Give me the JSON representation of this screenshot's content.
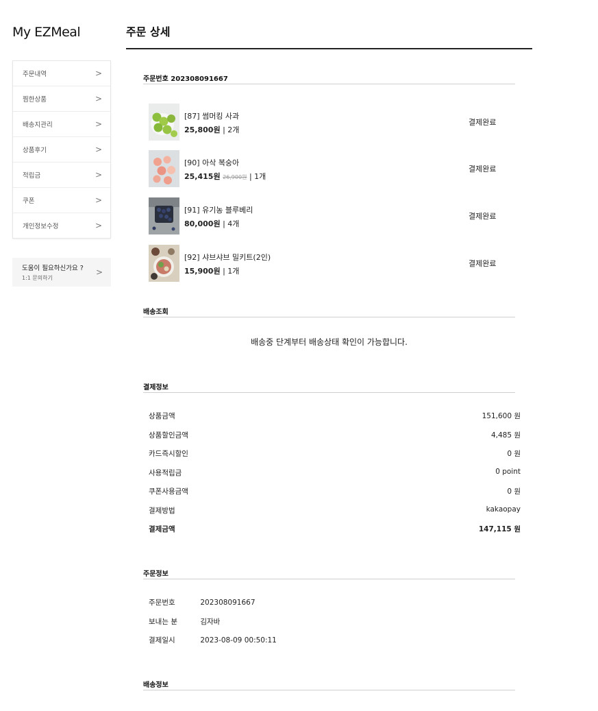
{
  "brand": "My EZMeal",
  "sidebar": {
    "items": [
      {
        "label": "주문내역"
      },
      {
        "label": "찜한상품"
      },
      {
        "label": "배송지관리"
      },
      {
        "label": "상품후기"
      },
      {
        "label": "적립금"
      },
      {
        "label": "쿠폰"
      },
      {
        "label": "개인정보수정"
      }
    ],
    "chevron": ">",
    "help": {
      "title": "도움이 필요하신가요 ?",
      "sub": "1:1 문의하기"
    }
  },
  "page": {
    "title": "주문 상세"
  },
  "order": {
    "header": "주문번호 202308091667",
    "products": [
      {
        "name": "[87] 썸머킹 사과",
        "price": "25,800원",
        "original": "",
        "qty": "| 2개",
        "status": "결제완료",
        "image": "green-apples"
      },
      {
        "name": "[90] 아삭 복숭아",
        "price": "25,415원",
        "original": "26,900원",
        "qty": "| 1개",
        "status": "결제완료",
        "image": "peaches"
      },
      {
        "name": "[91] 유기농 블루베리",
        "price": "80,000원",
        "original": "",
        "qty": "| 4개",
        "status": "결제완료",
        "image": "blueberries"
      },
      {
        "name": "[92] 샤브샤브 밀키트(2인)",
        "price": "15,900원",
        "original": "",
        "qty": "| 1개",
        "status": "결제완료",
        "image": "shabu-shabu-meal-kit"
      }
    ]
  },
  "delivery": {
    "header": "배송조회",
    "notice": "배송중 단계부터 배송상태 확인이 가능합니다."
  },
  "payment": {
    "header": "결제정보",
    "rows": [
      {
        "label": "상품금액",
        "value": "151,600 원"
      },
      {
        "label": "상품할인금액",
        "value": "4,485 원"
      },
      {
        "label": "카드즉시할인",
        "value": "0 원"
      },
      {
        "label": "사용적립금",
        "value": "0 point"
      },
      {
        "label": "쿠폰사용금액",
        "value": "0 원"
      },
      {
        "label": "결제방법",
        "value": "kakaopay"
      },
      {
        "label": "결제금액",
        "value": "147,115 원"
      }
    ]
  },
  "order_info": {
    "header": "주문정보",
    "rows": [
      {
        "label": "주문번호",
        "value": "202308091667"
      },
      {
        "label": "보내는 분",
        "value": "김자바"
      },
      {
        "label": "결제일시",
        "value": "2023-08-09 00:50:11"
      }
    ]
  },
  "shipping": {
    "header": "배송정보"
  }
}
